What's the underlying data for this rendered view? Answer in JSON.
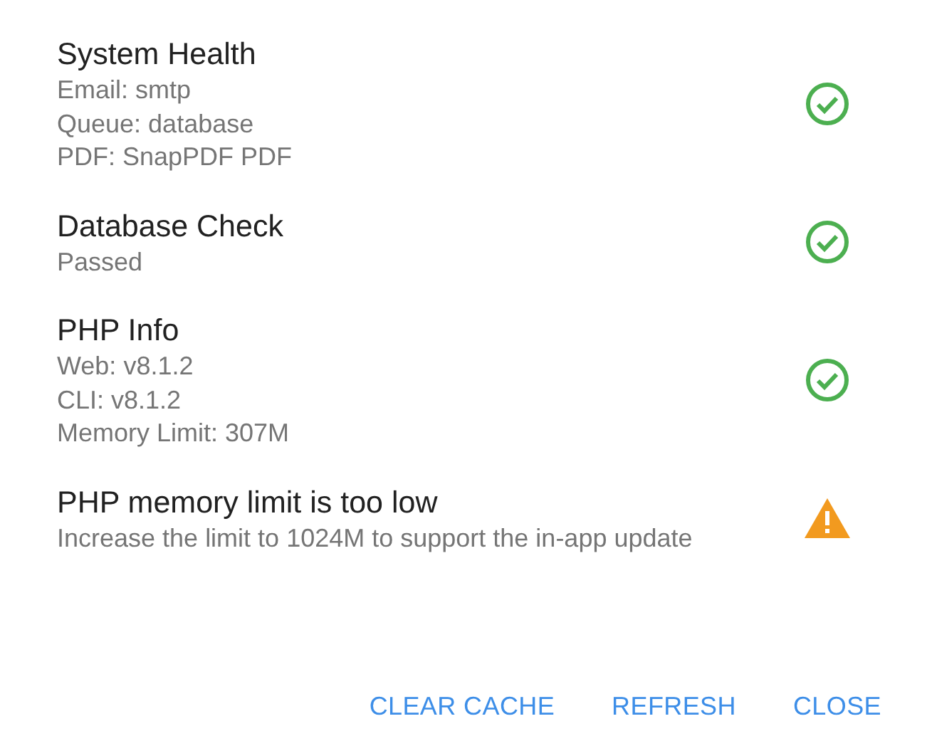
{
  "checks": [
    {
      "kind": "ok",
      "title": "System Health",
      "lines": [
        "Email: smtp",
        "Queue: database",
        "PDF: SnapPDF PDF"
      ]
    },
    {
      "kind": "ok",
      "title": "Database Check",
      "lines": [
        "Passed"
      ]
    },
    {
      "kind": "ok",
      "title": "PHP Info",
      "lines": [
        "Web: v8.1.2",
        "CLI: v8.1.2",
        "Memory Limit: 307M"
      ]
    },
    {
      "kind": "warning",
      "title": "PHP memory limit is too low",
      "lines": [
        "Increase the limit to 1024M to support the in-app update"
      ]
    }
  ],
  "buttons": [
    "CLEAR CACHE",
    "REFRESH",
    "CLOSE"
  ]
}
